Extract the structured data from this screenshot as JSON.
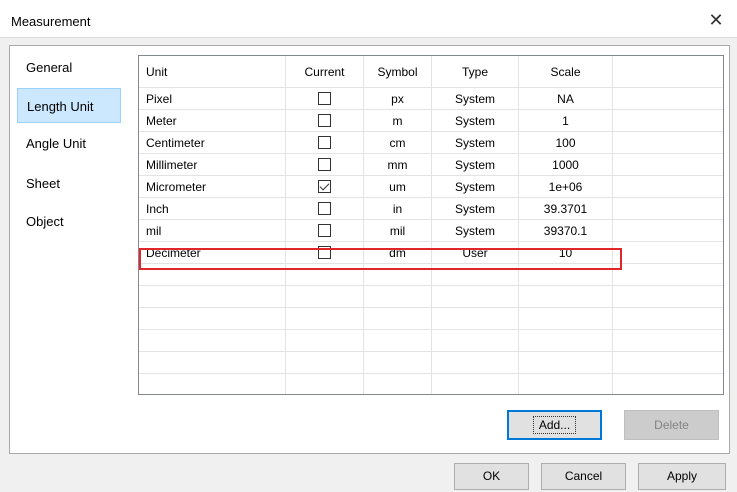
{
  "window": {
    "title": "Measurement",
    "close_symbol": "✕"
  },
  "sidebar": {
    "items": [
      {
        "label": "General",
        "selected": false
      },
      {
        "label": "Length Unit",
        "selected": true
      },
      {
        "label": "Angle Unit",
        "selected": false
      },
      {
        "label": "Sheet",
        "selected": false
      },
      {
        "label": "Object",
        "selected": false
      }
    ]
  },
  "table": {
    "headers": [
      "Unit",
      "Current",
      "Symbol",
      "Type",
      "Scale"
    ],
    "rows": [
      {
        "unit": "Pixel",
        "current": false,
        "symbol": "px",
        "type": "System",
        "scale": "NA"
      },
      {
        "unit": "Meter",
        "current": false,
        "symbol": "m",
        "type": "System",
        "scale": "1"
      },
      {
        "unit": "Centimeter",
        "current": false,
        "symbol": "cm",
        "type": "System",
        "scale": "100"
      },
      {
        "unit": "Millimeter",
        "current": false,
        "symbol": "mm",
        "type": "System",
        "scale": "1000"
      },
      {
        "unit": "Micrometer",
        "current": true,
        "symbol": "um",
        "type": "System",
        "scale": "1e+06"
      },
      {
        "unit": "Inch",
        "current": false,
        "symbol": "in",
        "type": "System",
        "scale": "39.3701"
      },
      {
        "unit": "mil",
        "current": false,
        "symbol": "mil",
        "type": "System",
        "scale": "39370.1"
      },
      {
        "unit": "Decimeter",
        "current": false,
        "symbol": "dm",
        "type": "User",
        "scale": "10"
      }
    ],
    "highlight_color": "#e0262b"
  },
  "buttons": {
    "add": "Add...",
    "delete": "Delete",
    "ok": "OK",
    "cancel": "Cancel",
    "apply": "Apply"
  }
}
